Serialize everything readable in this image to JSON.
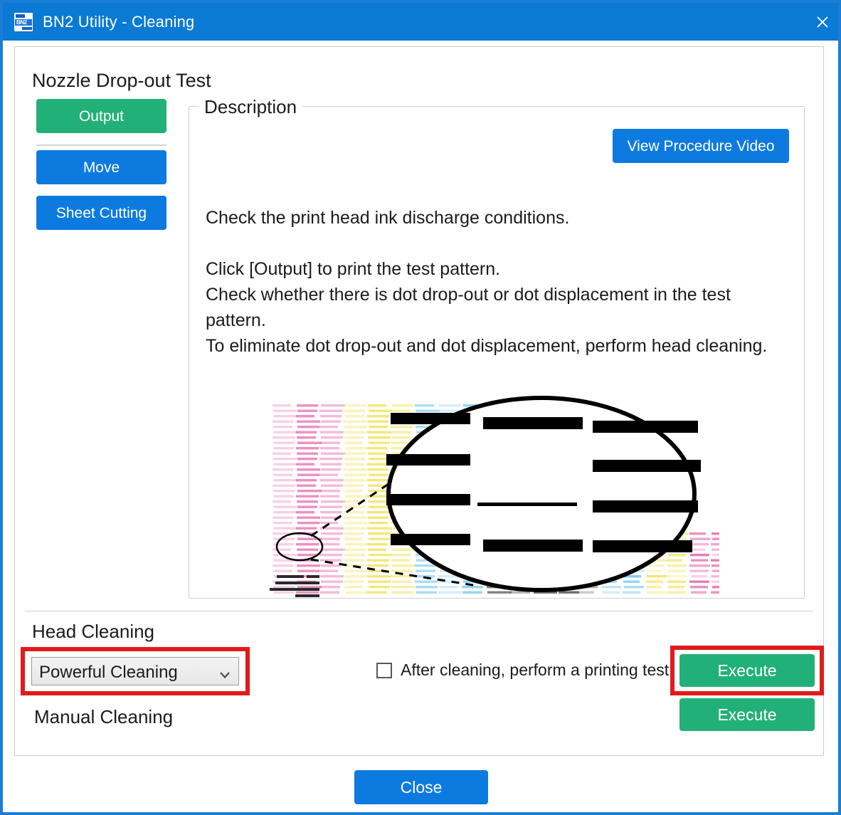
{
  "window": {
    "title": "BN2 Utility - Cleaning",
    "app_icon": "bn2-app-icon",
    "icon_glyph": "BN2",
    "close_icon": "close-icon",
    "titlebar_color": "#0a7ad4",
    "border_color": "#1a7fd4"
  },
  "main": {
    "nozzle_section_title": "Nozzle Drop-out Test",
    "buttons": {
      "output": "Output",
      "move": "Move",
      "sheet_cutting": "Sheet Cutting",
      "view_procedure_video": "View Procedure Video"
    },
    "description": {
      "legend": "Description",
      "line1": "Check the print head ink discharge conditions.",
      "line2": "Click [Output] to print the test pattern.",
      "line3": "Check whether there is dot drop-out or dot displacement in the test pattern.",
      "line4": "To eliminate dot drop-out and dot displacement, perform head cleaning."
    },
    "illustration": {
      "name": "nozzle-test-pattern-illustration",
      "band_colors": [
        "#e87ab4",
        "#f5e87a",
        "#7ecdf0",
        "#6b6b6b"
      ],
      "magnifier": "magnified-ellipse-callout"
    }
  },
  "head_cleaning": {
    "section_label": "Head Cleaning",
    "cleaning_mode": "Powerful Cleaning",
    "cleaning_mode_options": [
      "Powerful Cleaning"
    ],
    "printing_test_checkbox_label": "After cleaning, perform a printing test",
    "printing_test_checked": false,
    "execute_label": "Execute",
    "manual_cleaning_label": "Manual Cleaning",
    "manual_execute_label": "Execute",
    "highlight_color": "#e01b1b"
  },
  "footer": {
    "close_label": "Close"
  },
  "colors": {
    "green": "#21b178",
    "blue": "#0d7ae0",
    "red_highlight": "#e01b1b"
  }
}
